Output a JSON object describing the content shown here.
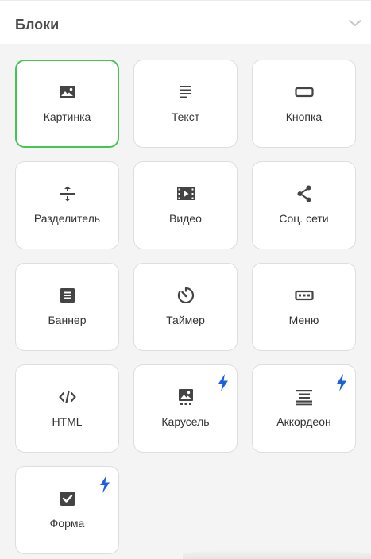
{
  "header": {
    "title": "Блоки",
    "collapse_icon": "chevron-down-icon"
  },
  "accent_colors": {
    "selected_border": "#46c553",
    "bolt": "#1a5fe0",
    "icon": "#444444"
  },
  "blocks": [
    {
      "label": "Картинка",
      "icon": "image-icon",
      "selected": true,
      "premium": false
    },
    {
      "label": "Текст",
      "icon": "text-icon",
      "selected": false,
      "premium": false
    },
    {
      "label": "Кнопка",
      "icon": "button-icon",
      "selected": false,
      "premium": false
    },
    {
      "label": "Разделитель",
      "icon": "divider-icon",
      "selected": false,
      "premium": false
    },
    {
      "label": "Видео",
      "icon": "video-icon",
      "selected": false,
      "premium": false
    },
    {
      "label": "Соц. сети",
      "icon": "share-icon",
      "selected": false,
      "premium": false
    },
    {
      "label": "Баннер",
      "icon": "banner-icon",
      "selected": false,
      "premium": false
    },
    {
      "label": "Таймер",
      "icon": "timer-icon",
      "selected": false,
      "premium": false
    },
    {
      "label": "Меню",
      "icon": "menu-icon",
      "selected": false,
      "premium": false
    },
    {
      "label": "HTML",
      "icon": "code-icon",
      "selected": false,
      "premium": false
    },
    {
      "label": "Карусель",
      "icon": "carousel-icon",
      "selected": false,
      "premium": true
    },
    {
      "label": "Аккордеон",
      "icon": "accordion-icon",
      "selected": false,
      "premium": true
    },
    {
      "label": "Форма",
      "icon": "form-checkbox-icon",
      "selected": false,
      "premium": true
    }
  ]
}
